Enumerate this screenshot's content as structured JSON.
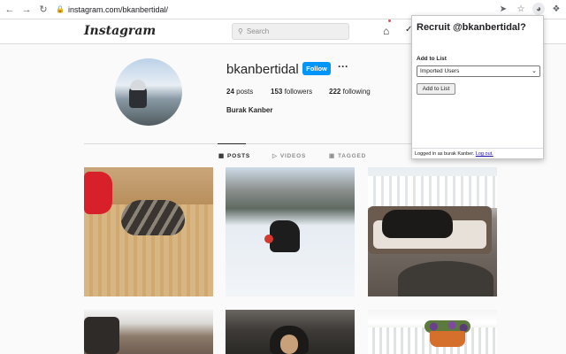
{
  "browser": {
    "url": "instagram.com/bkanbertidal/",
    "back_icon": "arrow-left-icon",
    "forward_icon": "arrow-right-icon",
    "reload_icon": "reload-icon"
  },
  "header": {
    "logo": "Instagram",
    "search_placeholder": "Search",
    "notification_color": "#ed4956"
  },
  "profile": {
    "username": "bkanbertidal",
    "follow_label": "Follow",
    "more_label": "···",
    "posts_count": "24",
    "posts_label": " posts",
    "followers_count": "153",
    "followers_label": " followers",
    "following_count": "222",
    "following_label": " following",
    "full_name": "Burak Kanber",
    "accent_color": "#0095f6"
  },
  "tabs": [
    {
      "label": "POSTS",
      "active": true
    },
    {
      "label": "VIDEOS",
      "active": false
    },
    {
      "label": "TAGGED",
      "active": false
    }
  ],
  "popup": {
    "title": "Recruit @bkanbertidal?",
    "add_to_list_label": "Add to List",
    "selected_list": "Imported Users",
    "add_button": "Add to List",
    "footer_text": "Logged in as burak Kanber. ",
    "logout_link": "Log out."
  }
}
